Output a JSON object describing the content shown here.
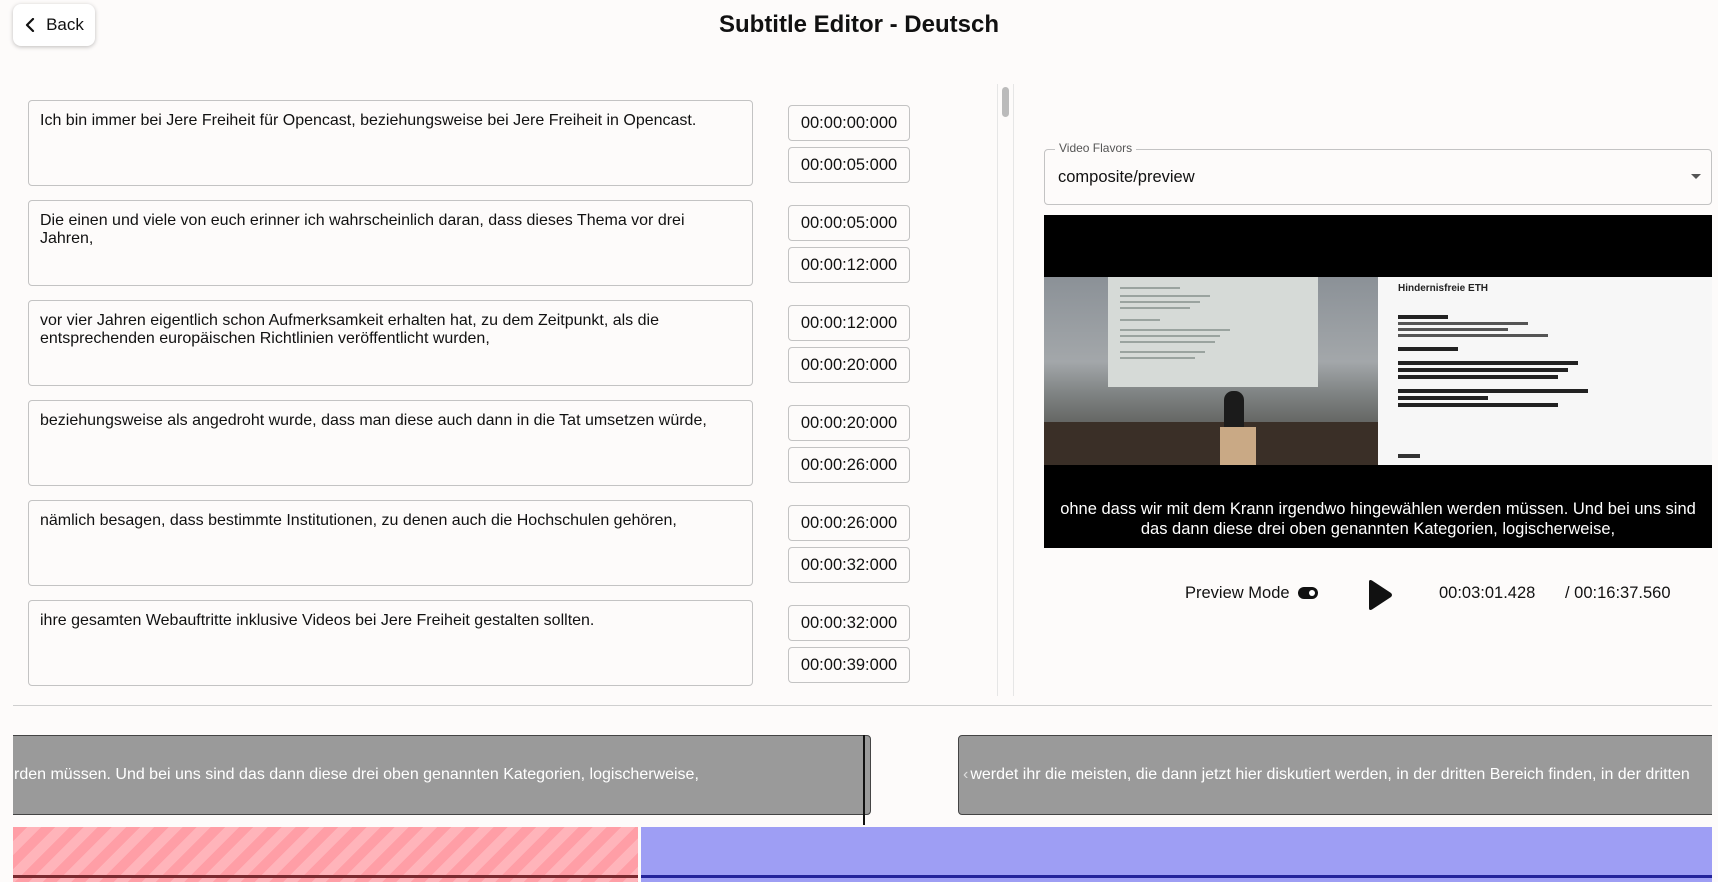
{
  "header": {
    "back_label": "Back",
    "title": "Subtitle Editor - Deutsch"
  },
  "segments": [
    {
      "text": "Ich bin immer bei Jere Freiheit für Opencast, beziehungsweise bei Jere Freiheit in Opencast.",
      "start": "00:00:00:000",
      "end": "00:00:05:000"
    },
    {
      "text": "Die einen und viele von euch erinner ich wahrscheinlich daran, dass dieses Thema vor drei Jahren,",
      "start": "00:00:05:000",
      "end": "00:00:12:000"
    },
    {
      "text": "vor vier Jahren eigentlich schon Aufmerksamkeit erhalten hat, zu dem Zeitpunkt, als die entsprechenden europäischen Richtlinien veröffentlicht wurden,",
      "start": "00:00:12:000",
      "end": "00:00:20:000"
    },
    {
      "text": "beziehungsweise als angedroht wurde, dass man diese auch dann in die Tat umsetzen würde,",
      "start": "00:00:20:000",
      "end": "00:00:26:000"
    },
    {
      "text": "nämlich besagen, dass bestimmte Institutionen, zu denen auch die Hochschulen gehören,",
      "start": "00:00:26:000",
      "end": "00:00:32:000"
    },
    {
      "text": "ihre gesamten Webauftritte inklusive Videos bei Jere Freiheit gestalten sollten.",
      "start": "00:00:32:000",
      "end": "00:00:39:000"
    }
  ],
  "video_flavors": {
    "label": "Video Flavors",
    "selected": "composite/preview"
  },
  "video": {
    "slide_title": "Hindernisfreie ETH",
    "caption": "ohne dass wir mit dem Krann irgendwo hingewählen werden müssen. Und bei uns sind das dann diese drei oben genannten Kategorien, logischerweise,"
  },
  "controls": {
    "preview_mode_label": "Preview Mode",
    "current_time": "00:03:01.428",
    "total_time": "/ 00:16:37.560"
  },
  "timeline": {
    "seg_left": "rden müssen. Und bei uns sind das dann diese drei oben genannten Kategorien, logischerweise,",
    "seg_right": "werdet ihr die meisten, die dann jetzt hier diskutiert werden, in der dritten Bereich finden, in der dritten"
  },
  "colors": {
    "waveform_left": "#ff9ea6",
    "waveform_right": "#9e9ef4",
    "timeline_segment": "#9a9a9a"
  }
}
